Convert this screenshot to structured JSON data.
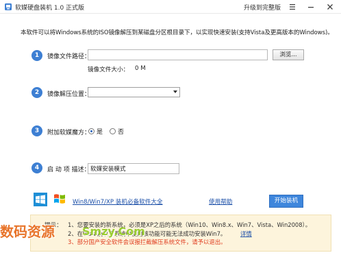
{
  "titlebar": {
    "title": "软媒硬盘装机 1.0 正式版",
    "upgrade": "升级到完整版",
    "icons": [
      "app-icon",
      "menu-icon",
      "minimize-icon",
      "close-icon"
    ]
  },
  "intro": "本软件可以将Windows系统的ISO镜像解压到某磁盘分区根目录下，以实现快速安装(支持Vista及更高版本的Windows)。",
  "steps": [
    {
      "num": "1",
      "label": "镜像文件路径："
    },
    {
      "num": "2",
      "label": "镜像解压位置："
    },
    {
      "num": "3",
      "label": "附加软媒魔方："
    },
    {
      "num": "4",
      "label": "启 动 项 描述："
    }
  ],
  "image_path": {
    "value": "",
    "browse": "浏览..."
  },
  "image_size": {
    "label": "镜像文件大小：",
    "value": "0 M"
  },
  "extract_location": {
    "selected": ""
  },
  "cube_option": {
    "yes": "是",
    "no": "否",
    "selected": "yes"
  },
  "boot_description": {
    "value": "软媒安装模式"
  },
  "bottom": {
    "tools_link": "Win8/Win7/XP 装机必备软件大全",
    "help_link": "使用帮助",
    "start_button": "开始装机"
  },
  "tips": {
    "label": "提示：",
    "items": [
      "1、您要安装的新系统，必须是XP之后的系统（Win10、Win8.x、Win7、Vista、Win2008）。",
      "2、在Vista及以下系统中使用该功能可能无法成功安装Win7。",
      "3、部分国产安全软件会误报拦截解压系统文件，请予以退出。"
    ],
    "detail_link": "详情"
  },
  "watermark": {
    "left": "数码资源",
    "right": "Smzy.Com"
  },
  "colors": {
    "accent": "#3d7fd3",
    "link": "#1b4fa8",
    "warning": "#e03c1e",
    "tips_bg": "#fdf4dc"
  }
}
